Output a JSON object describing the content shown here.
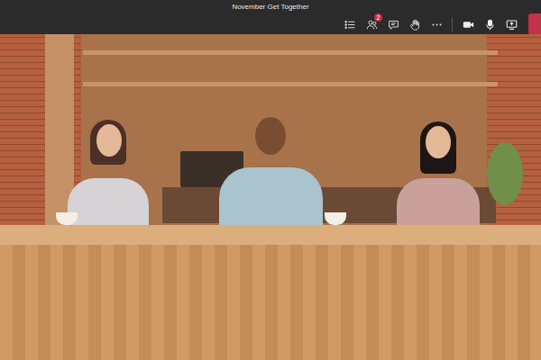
{
  "window": {
    "title": "November Get Together"
  },
  "toolbar": {
    "participants_badge": "2"
  }
}
